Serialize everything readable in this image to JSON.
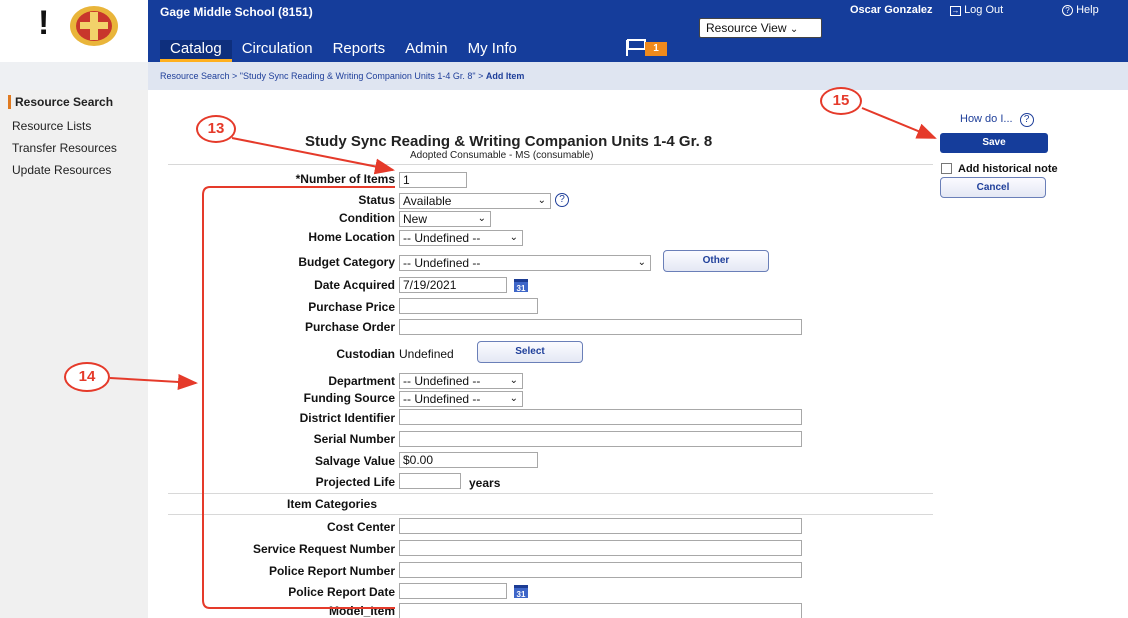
{
  "header": {
    "logo_glyph": "!",
    "school": "Gage Middle School (8151)",
    "resource_view": "Resource View",
    "user": "Oscar Gonzalez",
    "logout": "Log Out",
    "help": "Help",
    "flag_count": "1",
    "nav": [
      "Catalog",
      "Circulation",
      "Reports",
      "Admin",
      "My Info"
    ]
  },
  "breadcrumb": {
    "prefix": "Resource Search > \"Study Sync Reading & Writing Companion Units 1-4 Gr. 8\" > ",
    "current": "Add Item"
  },
  "sidebar": {
    "items": [
      "Resource Search",
      "Resource Lists",
      "Transfer Resources",
      "Update Resources"
    ]
  },
  "form": {
    "title": "Study Sync Reading & Writing Companion Units 1-4 Gr. 8",
    "subtitle": "Adopted Consumable - MS (consumable)",
    "number_of_items_label": "*Number of Items",
    "number_of_items_value": "1",
    "status_label": "Status",
    "status_value": "Available",
    "condition_label": "Condition",
    "condition_value": "New",
    "home_location_label": "Home Location",
    "home_location_value": "-- Undefined --",
    "budget_category_label": "Budget Category",
    "budget_category_value": "-- Undefined --",
    "other_button": "Other",
    "date_acquired_label": "Date Acquired",
    "date_acquired_value": "7/19/2021",
    "calendar_day": "31",
    "purchase_price_label": "Purchase Price",
    "purchase_order_label": "Purchase Order",
    "custodian_label": "Custodian",
    "custodian_value": "Undefined",
    "select_button": "Select",
    "department_label": "Department",
    "department_value": "-- Undefined --",
    "funding_source_label": "Funding Source",
    "funding_source_value": "-- Undefined --",
    "district_identifier_label": "District Identifier",
    "serial_number_label": "Serial Number",
    "salvage_value_label": "Salvage Value",
    "salvage_value_value": "$0.00",
    "projected_life_label": "Projected Life",
    "years_label": "years",
    "item_categories_label": "Item Categories",
    "cost_center_label": "Cost Center",
    "service_request_label": "Service Request Number",
    "police_report_number_label": "Police Report Number",
    "police_report_date_label": "Police Report Date",
    "model_item_label": "Model_Item"
  },
  "right": {
    "how_do_i": "How do I...",
    "how_qmark": "?",
    "save": "Save",
    "historical_note": "Add historical note",
    "cancel": "Cancel"
  },
  "annotations": {
    "a13": "13",
    "a14": "14",
    "a15": "15",
    "color": "#e53a2a"
  }
}
